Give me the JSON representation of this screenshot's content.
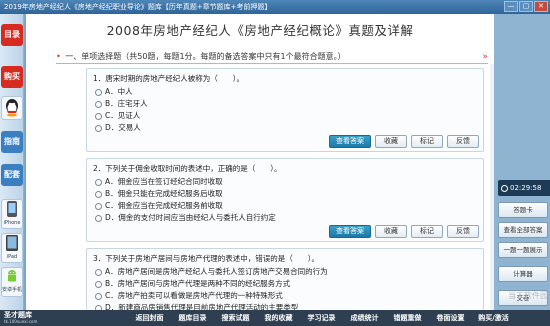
{
  "window": {
    "title": "2019年房地产经纪人《房地产经纪职业导论》题库【历年真题+章节题库+考前押题】",
    "controls": [
      "—",
      "▢",
      "✕"
    ]
  },
  "sidebar": {
    "menu_label": "目录",
    "buy_label": "购买",
    "items": [
      {
        "label": "",
        "icon": "qq-icon"
      },
      {
        "label": "指南",
        "icon": "guide-icon"
      },
      {
        "label": "配套",
        "icon": "package-icon"
      },
      {
        "label": "iPhone",
        "icon": "iphone-icon"
      },
      {
        "label": "iPad",
        "icon": "ipad-icon"
      },
      {
        "label": "安卓手机",
        "icon": "android-icon"
      }
    ]
  },
  "main": {
    "title": "2008年房地产经纪人《房地产经纪概论》真题及详解",
    "section_heading": "一、单项选择题（共50题，每题1分。每题的备选答案中只有1个最符合题意。）",
    "action_labels": {
      "answer": "查看答案",
      "favorite": "收藏",
      "mark": "标记",
      "feedback": "反馈"
    },
    "questions": [
      {
        "text": "1．唐宋时期的房地产经纪人被称为（　　）。",
        "options": [
          "A．中人",
          "B．庄宅牙人",
          "C．见证人",
          "D．交易人"
        ]
      },
      {
        "text": "2．下列关于佣金收取时间的表述中，正确的是（　　）。",
        "options": [
          "A．佣金应当在签订经纪合同时收取",
          "B．佣金只能在完成经纪服务后收取",
          "C．佣金应当在完成经纪服务前收取",
          "D．佣金的支付时间应当由经纪人与委托人自行约定"
        ]
      },
      {
        "text": "3．下列关于房地产居间与房地产代理的表述中，错误的是（　　）。",
        "options": [
          "A．房地产居间是房地产经纪人与委托人签订房地产交易合同的行为",
          "B．房地产居间与房地产代理是两种不同的经纪服务方式",
          "C．房地产拍卖可以看做是房地产代理的一种特殊形式",
          "D．新建商品房销售代理是目前房地产代理活动的主要类型"
        ]
      }
    ]
  },
  "right_panel": {
    "timer": "02:29:58",
    "buttons": [
      "答题卡",
      "查看全部答案",
      "一题一题展示",
      "计算器",
      "交卷"
    ]
  },
  "bottom_nav": {
    "logo_text": "圣才题库",
    "logo_sub": "tk.100xuexi.com",
    "items": [
      "返回封面",
      "题库目录",
      "搜索试题",
      "我的收藏",
      "学习记录",
      "成绩统计",
      "错题重做",
      "卷面设置",
      "购买/激活"
    ]
  },
  "watermark": "当下软件园"
}
